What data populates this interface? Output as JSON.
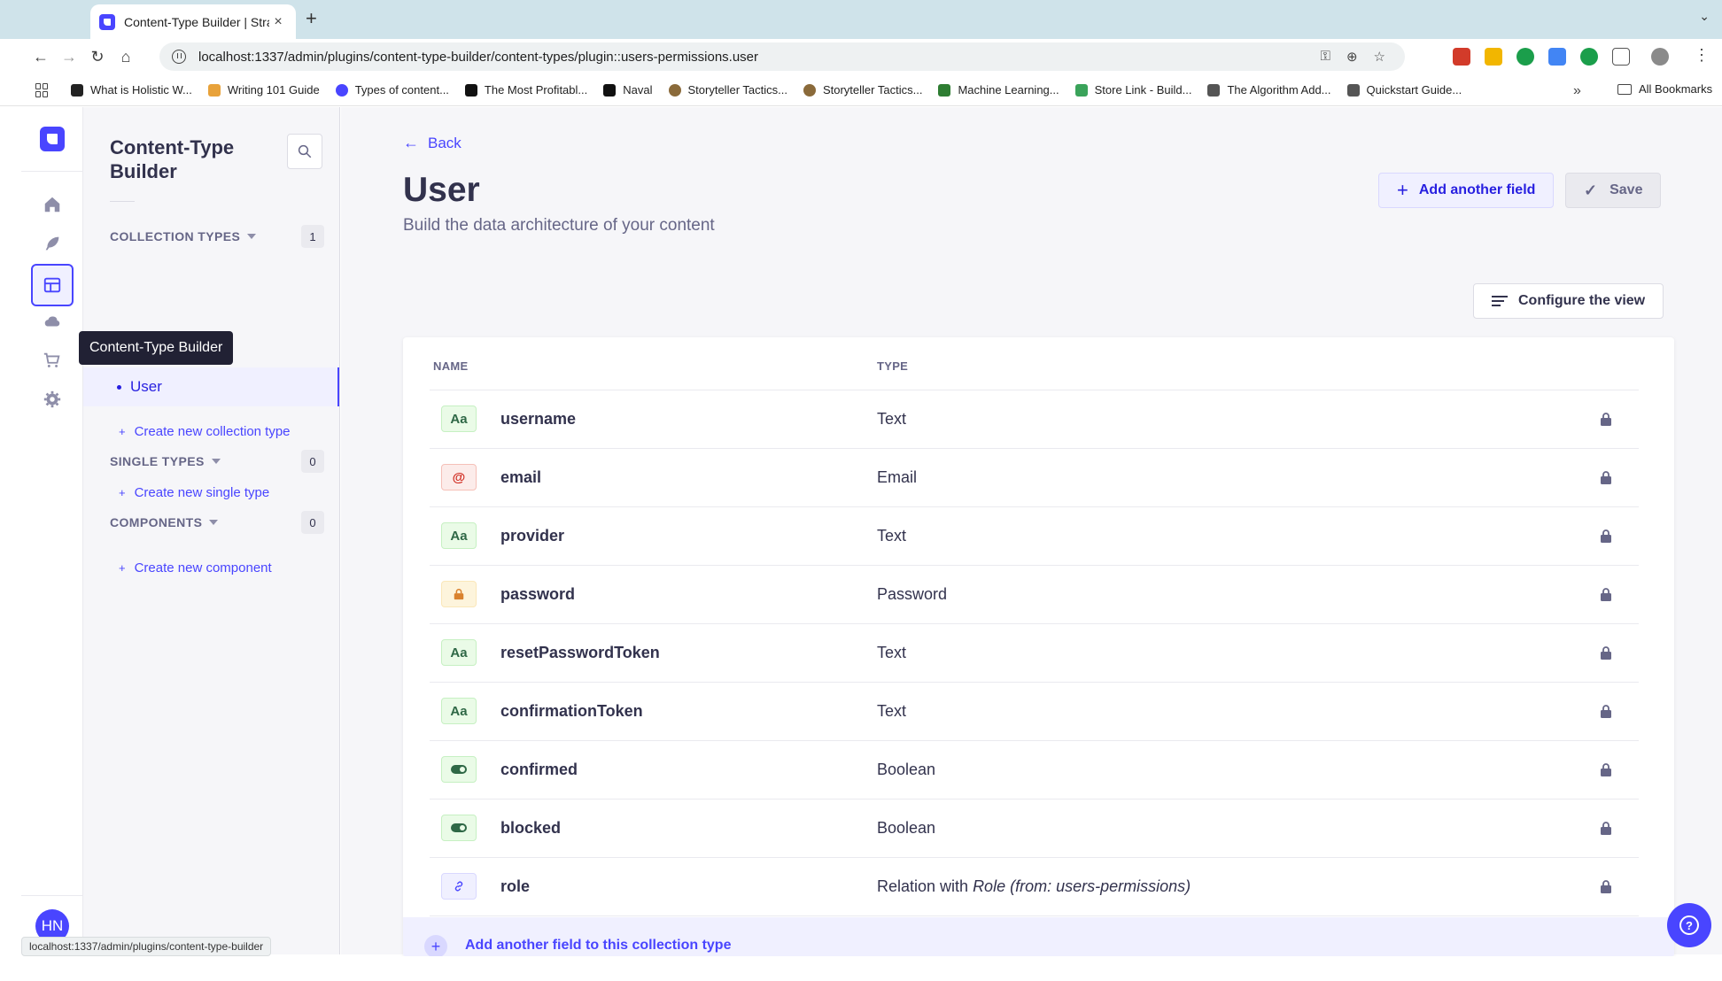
{
  "browser": {
    "tab_title": "Content-Type Builder | Strapi",
    "tab_close": "×",
    "new_tab": "+",
    "url": "localhost:1337/admin/plugins/content-type-builder/content-types/plugin::users-permissions.user",
    "status_url": "localhost:1337/admin/plugins/content-type-builder",
    "bookmarks": [
      {
        "label": "What is Holistic W...",
        "color": "#222222"
      },
      {
        "label": "Writing 101 Guide",
        "color": "#e8a23a"
      },
      {
        "label": "Types of content...",
        "color": "#4945ff"
      },
      {
        "label": "The Most Profitabl...",
        "color": "#111111"
      },
      {
        "label": "Naval",
        "color": "#111111"
      },
      {
        "label": "Storyteller Tactics...",
        "color": "#8a6a3a"
      },
      {
        "label": "Storyteller Tactics...",
        "color": "#8a6a3a"
      },
      {
        "label": "Machine Learning...",
        "color": "#2e7d32"
      },
      {
        "label": "Store Link - Build...",
        "color": "#3aa35a"
      },
      {
        "label": "The Algorithm Add...",
        "color": "#555555"
      },
      {
        "label": "Quickstart Guide...",
        "color": "#555555"
      }
    ],
    "bookmarks_more": "»",
    "all_bookmarks": "All Bookmarks",
    "extension_colors": [
      "#d23b2a",
      "#f2b600",
      "#1b9e4b",
      "#4285f4",
      "#1b9e4b",
      "#666666"
    ]
  },
  "mainnav": {
    "avatar_initials": "HN",
    "tooltip": "Content-Type Builder",
    "brand_color": "#4945ff"
  },
  "subnav": {
    "title": "Content-Type Builder",
    "collection_types": {
      "label": "COLLECTION TYPES",
      "count": "1"
    },
    "active_item": "User",
    "create_collection": "Create new collection type",
    "single_types": {
      "label": "SINGLE TYPES",
      "count": "0"
    },
    "create_single": "Create new single type",
    "components": {
      "label": "COMPONENTS",
      "count": "0"
    },
    "create_component": "Create new component"
  },
  "main": {
    "back_label": "Back",
    "title": "User",
    "subtitle": "Build the data architecture of your content",
    "add_field_label": "Add another field",
    "save_label": "Save",
    "configure_label": "Configure the view",
    "table": {
      "col_name": "NAME",
      "col_type": "TYPE",
      "rows": [
        {
          "icon": "text-field-icon",
          "icon_text": "Aa",
          "name": "username",
          "type": "Text"
        },
        {
          "icon": "email-field-icon",
          "icon_text": "@",
          "name": "email",
          "type": "Email"
        },
        {
          "icon": "text-field-icon",
          "icon_text": "Aa",
          "name": "provider",
          "type": "Text"
        },
        {
          "icon": "password-field-icon",
          "icon_text": "",
          "name": "password",
          "type": "Password"
        },
        {
          "icon": "text-field-icon",
          "icon_text": "Aa",
          "name": "resetPasswordToken",
          "type": "Text"
        },
        {
          "icon": "text-field-icon",
          "icon_text": "Aa",
          "name": "confirmationToken",
          "type": "Text"
        },
        {
          "icon": "boolean-field-icon",
          "icon_text": "",
          "name": "confirmed",
          "type": "Boolean"
        },
        {
          "icon": "boolean-field-icon",
          "icon_text": "",
          "name": "blocked",
          "type": "Boolean"
        },
        {
          "icon": "relation-field-icon",
          "icon_text": "",
          "name": "role",
          "type_prefix": "Relation with ",
          "type_target": "Role (from: users-permissions)"
        }
      ]
    },
    "add_footer_label": "Add another field to this collection type"
  },
  "colors": {
    "primary": "#4945ff",
    "primary_light": "#f0f0ff",
    "text": "#32324d",
    "muted": "#666687"
  }
}
